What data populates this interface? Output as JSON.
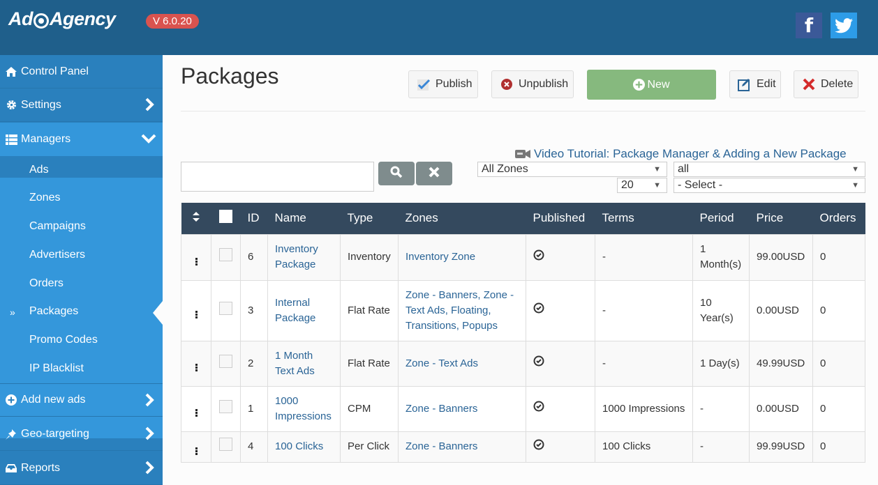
{
  "header": {
    "logo_text_left": "Ad",
    "logo_text_right": "Agency",
    "version": "V 6.0.20",
    "social": {
      "facebook": "f"
    }
  },
  "sidebar": {
    "items": [
      {
        "label": "Control Panel",
        "icon": "home-icon"
      },
      {
        "label": "Settings",
        "icon": "gear-icon",
        "chevron": "right"
      },
      {
        "label": "Managers",
        "icon": "list-icon",
        "chevron": "down"
      },
      {
        "label": "Add new ads",
        "icon": "plus-circle-icon",
        "chevron": "right"
      },
      {
        "label": "Geo-targeting",
        "icon": "pin-icon",
        "chevron": "right"
      },
      {
        "label": "Reports",
        "icon": "inbox-icon",
        "chevron": "right"
      }
    ],
    "managers_sub": [
      {
        "label": "Ads"
      },
      {
        "label": "Zones"
      },
      {
        "label": "Campaigns"
      },
      {
        "label": "Advertisers"
      },
      {
        "label": "Orders"
      },
      {
        "label": "Packages",
        "active": true,
        "marker": "»"
      },
      {
        "label": "Promo Codes"
      },
      {
        "label": "IP Blacklist"
      }
    ]
  },
  "page": {
    "title": "Packages",
    "toolbar": {
      "publish": "Publish",
      "unpublish": "Unpublish",
      "new": "New",
      "edit": "Edit",
      "delete": "Delete"
    },
    "video_tutorial": "Video Tutorial: Package Manager & Adding a New Package",
    "search": {
      "value": "",
      "placeholder": ""
    },
    "filters": {
      "zones": "All Zones",
      "status": "all",
      "per_page": "20",
      "type": "- Select -"
    }
  },
  "table": {
    "columns": [
      "",
      "",
      "ID",
      "Name",
      "Type",
      "Zones",
      "Published",
      "Terms",
      "Period",
      "Price",
      "Orders"
    ],
    "rows": [
      {
        "id": "6",
        "name": "Inventory Package",
        "type": "Inventory",
        "zones": "Inventory Zone",
        "published": true,
        "terms": "-",
        "period": "1 Month(s)",
        "price": "99.00USD",
        "orders": "0"
      },
      {
        "id": "3",
        "name": "Internal Package",
        "type": "Flat Rate",
        "zones": "Zone - Banners, Zone - Text Ads, Floating, Transitions, Popups",
        "published": true,
        "terms": "-",
        "period": "10 Year(s)",
        "price": "0.00USD",
        "orders": "0"
      },
      {
        "id": "2",
        "name": "1 Month Text Ads",
        "type": "Flat Rate",
        "zones": "Zone - Text Ads",
        "published": true,
        "terms": "-",
        "period": "1 Day(s)",
        "price": "49.99USD",
        "orders": "0"
      },
      {
        "id": "1",
        "name": "1000 Impressions",
        "type": "CPM",
        "zones": "Zone - Banners",
        "published": true,
        "terms": "1000 Impressions",
        "period": "-",
        "price": "0.00USD",
        "orders": "0"
      },
      {
        "id": "4",
        "name": "100 Clicks",
        "type": "Per Click",
        "zones": "Zone - Banners",
        "published": true,
        "terms": "100 Clicks",
        "period": "-",
        "price": "99.99USD",
        "orders": "0"
      }
    ]
  },
  "colors": {
    "topbar": "#1f5f8b",
    "sidebar": "#2a80bd",
    "sidebar_active_group": "#3497db",
    "table_header": "#34495e",
    "link": "#2a6496",
    "new_button": "#86b97e",
    "version_badge": "#d9534f"
  }
}
